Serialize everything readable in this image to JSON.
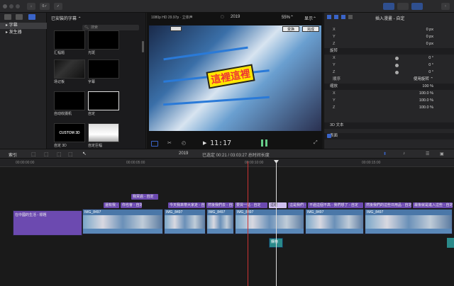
{
  "toolbar": {
    "import_label": "↓",
    "key_label": "0✓",
    "check_label": "✓"
  },
  "sidebar": {
    "items": [
      {
        "label": "字幕"
      },
      {
        "label": "发生器"
      }
    ]
  },
  "browser": {
    "title": "已安裝的字幕 ⌃",
    "search_placeholder": "搜索",
    "items": [
      {
        "label": "汇幅题"
      },
      {
        "label": "光斑"
      },
      {
        "label": "场记板"
      },
      {
        "label": "字幕"
      },
      {
        "label": "自动收摄机"
      },
      {
        "label": "自定"
      },
      {
        "label": "自定 3D"
      },
      {
        "label": "自定巨幅"
      }
    ],
    "thumb_texts": [
      "CUSTOM 3D"
    ]
  },
  "viewer": {
    "format": "1080p HD 29.97p · 立体声",
    "project": "2019",
    "zoom": "55%",
    "display": "显示",
    "caption": "這裡這裡",
    "btn_transform": "变换",
    "btn_done": "完成",
    "timecode": "11:17"
  },
  "inspector": {
    "title": "插入漫畫 - 自定",
    "rows": [
      {
        "k": "X",
        "v": "0 px"
      },
      {
        "k": "Y",
        "v": "0 px"
      },
      {
        "k": "Z",
        "v": "0 px"
      },
      {
        "k": "旋转",
        "v": "",
        "hdr": true
      },
      {
        "k": "X",
        "v": "0 °"
      },
      {
        "k": "Y",
        "v": "0 °"
      },
      {
        "k": "Z",
        "v": "0 °"
      },
      {
        "k": "顺序",
        "v": "使用旋转 ⌃"
      },
      {
        "k": "缩放",
        "v": "100 %",
        "hdr": true
      },
      {
        "k": "X",
        "v": "100.0 %"
      },
      {
        "k": "Y",
        "v": "100.0 %"
      },
      {
        "k": "Z",
        "v": "100.0 %"
      }
    ],
    "section_3d": "3D 文本",
    "section_face": "表面"
  },
  "timeline": {
    "index_label": "索引",
    "project": "2019",
    "selection": "已选定 00:21 / 03:03:27 总时间长度",
    "ruler": [
      "00:00:00:00",
      "00:00:05:00",
      "00:00:10:00",
      "00:00:15:00"
    ],
    "title_clips_row1": [
      {
        "label": "我買過 - 自定"
      }
    ],
    "title_clips_row2": [
      {
        "label": "還有我 - 自定"
      },
      {
        "label": "你也會 - 自定"
      },
      {
        "label": "今天我來帶大家走 - 自定"
      },
      {
        "label": "然後我們去 - 自定"
      },
      {
        "label": "要買一點 - 自定"
      },
      {
        "label": "這裡"
      },
      {
        "label": "這是我們 - 自定"
      },
      {
        "label": "不過這個不高 - 我們想了 - 自定"
      },
      {
        "label": "然後我們的這些日用品 - 自定"
      },
      {
        "label": "最後就是進入這些 - 自定"
      }
    ],
    "purple_clip": "在中國的生活 - 標題",
    "video_clips": [
      "IMG_8497",
      "IMG_8497",
      "IMG_8497",
      "IMG_8497",
      "IMG_8497",
      "IMG_8497"
    ],
    "small_clip": "購物"
  }
}
